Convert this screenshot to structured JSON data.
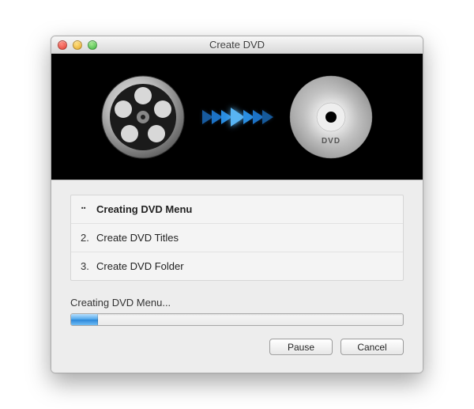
{
  "window": {
    "title": "Create DVD"
  },
  "steps": [
    {
      "num": "",
      "label": "Creating DVD Menu",
      "active": true
    },
    {
      "num": "2.",
      "label": "Create DVD Titles",
      "active": false
    },
    {
      "num": "3.",
      "label": "Create DVD Folder",
      "active": false
    }
  ],
  "status": "Creating DVD Menu...",
  "progress": {
    "percent": 8
  },
  "buttons": {
    "pause": "Pause",
    "cancel": "Cancel"
  },
  "banner": {
    "disc_label": "DVD"
  }
}
